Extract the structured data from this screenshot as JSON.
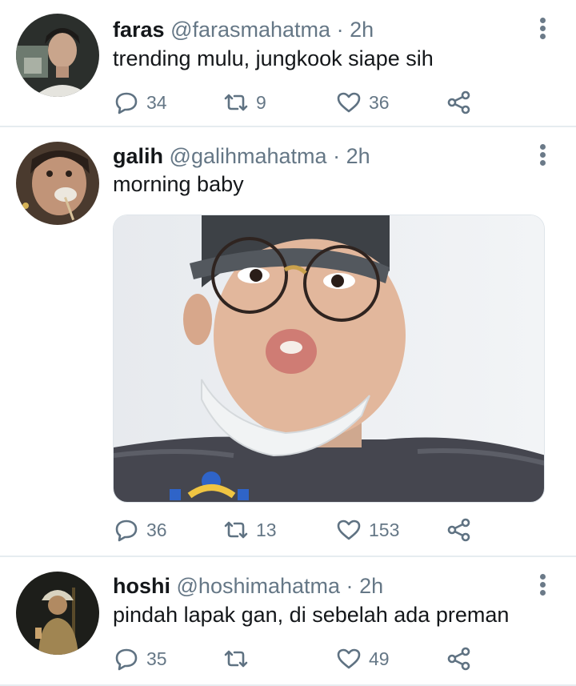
{
  "colors": {
    "text": "#14171a",
    "muted": "#657786",
    "divider": "#e6ecf0",
    "icon": "#5f7282"
  },
  "tweets": [
    {
      "name": "faras",
      "handle": "@farasmahatma",
      "separator": "·",
      "time": "2h",
      "text": "trending mulu, jungkook siape sih",
      "replies": "34",
      "retweets": "9",
      "likes": "36",
      "has_media": false
    },
    {
      "name": "galih",
      "handle": "@galihmahatma",
      "separator": "·",
      "time": "2h",
      "text": "morning baby",
      "replies": "36",
      "retweets": "13",
      "likes": "153",
      "has_media": true
    },
    {
      "name": "hoshi",
      "handle": "@hoshimahatma",
      "separator": "·",
      "time": "2h",
      "text": "pindah lapak gan, di sebelah ada preman",
      "replies": "35",
      "retweets": "",
      "likes": "49",
      "has_media": false
    }
  ],
  "icons": {
    "reply": "reply-icon",
    "retweet": "retweet-icon",
    "like": "heart-icon",
    "share": "share-icon",
    "more": "more-vertical-icon"
  }
}
